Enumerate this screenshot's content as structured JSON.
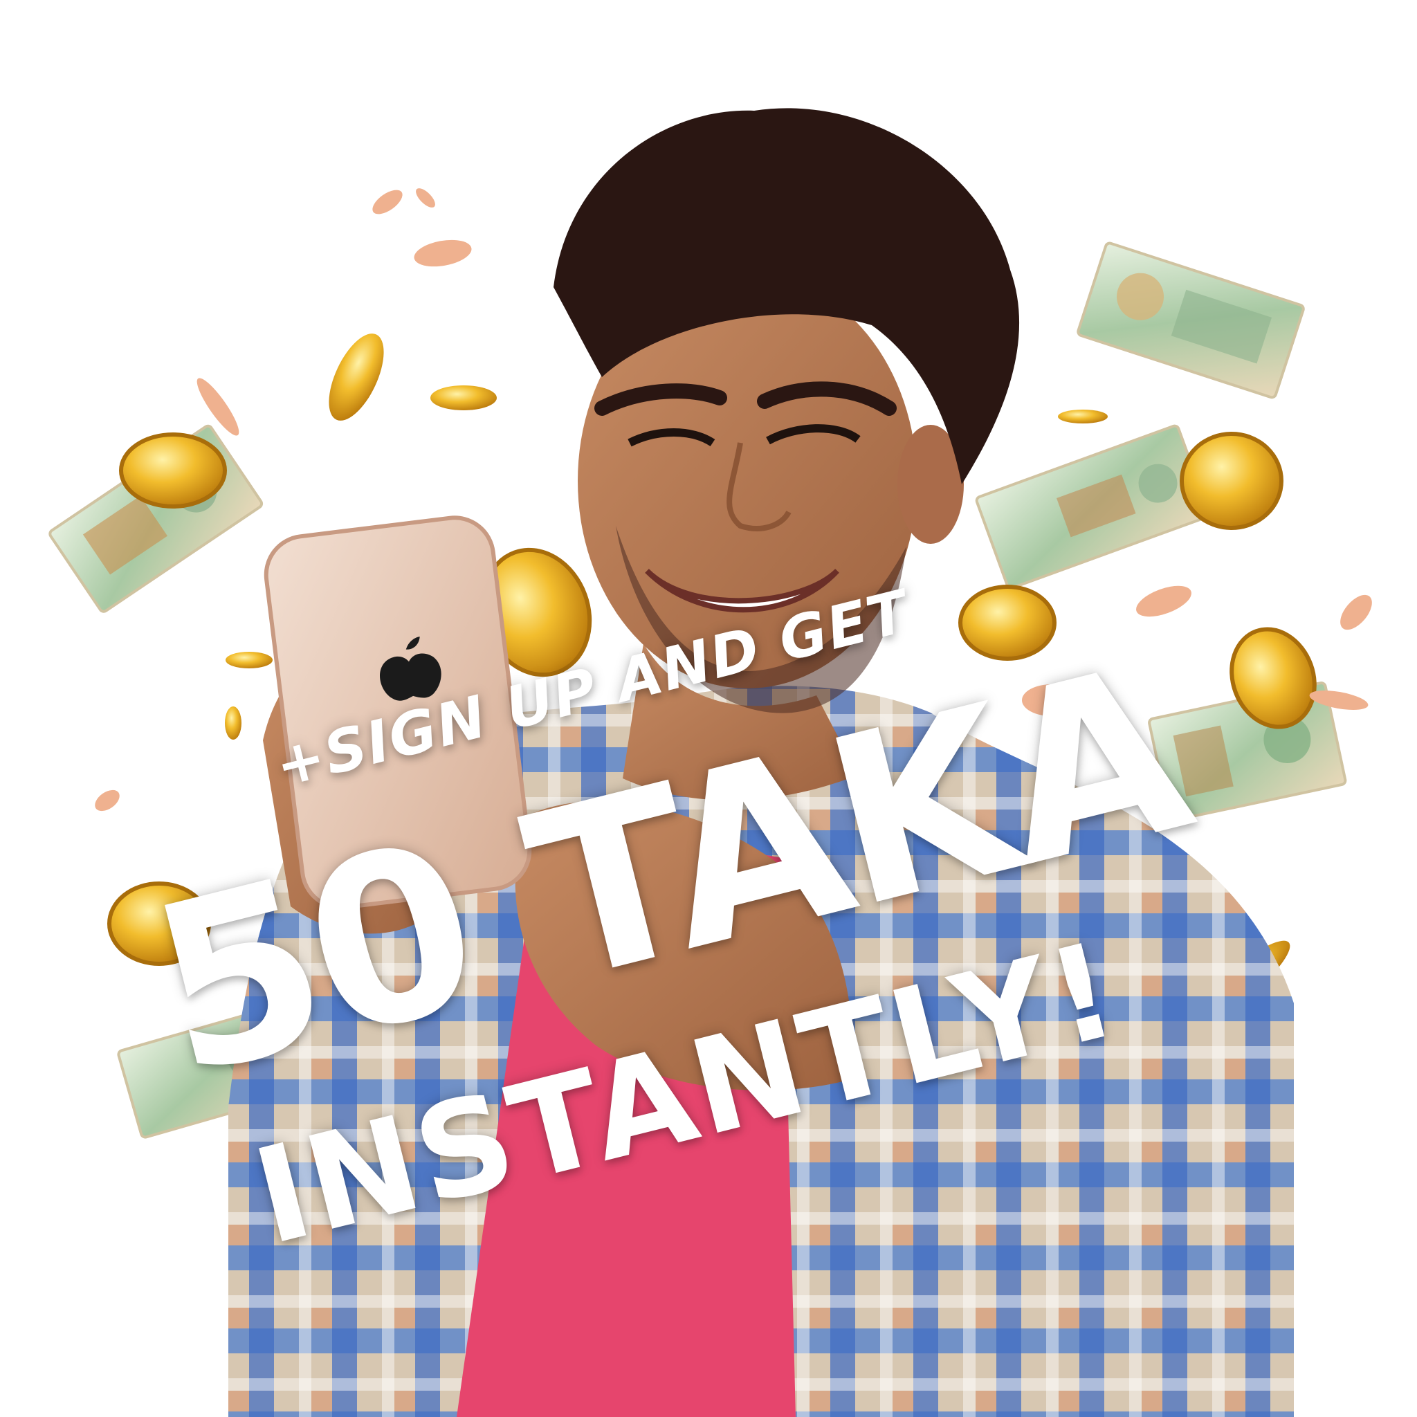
{
  "promo": {
    "line1": "+SIGN UP AND GET",
    "line2": "50 TAKA",
    "line3": "INSTANTLY!"
  },
  "colors": {
    "background": "#ffffff",
    "headline": "#ffffff",
    "shirt_blue": "#4a78c8",
    "shirt_tan": "#d9b48d",
    "tshirt_pink": "#e6456d",
    "skin": "#b97a54",
    "hair": "#2a1612",
    "phone": "#e8c9b5",
    "coin_gold": "#e0a41d",
    "banknote_green": "#a7c9a7"
  }
}
